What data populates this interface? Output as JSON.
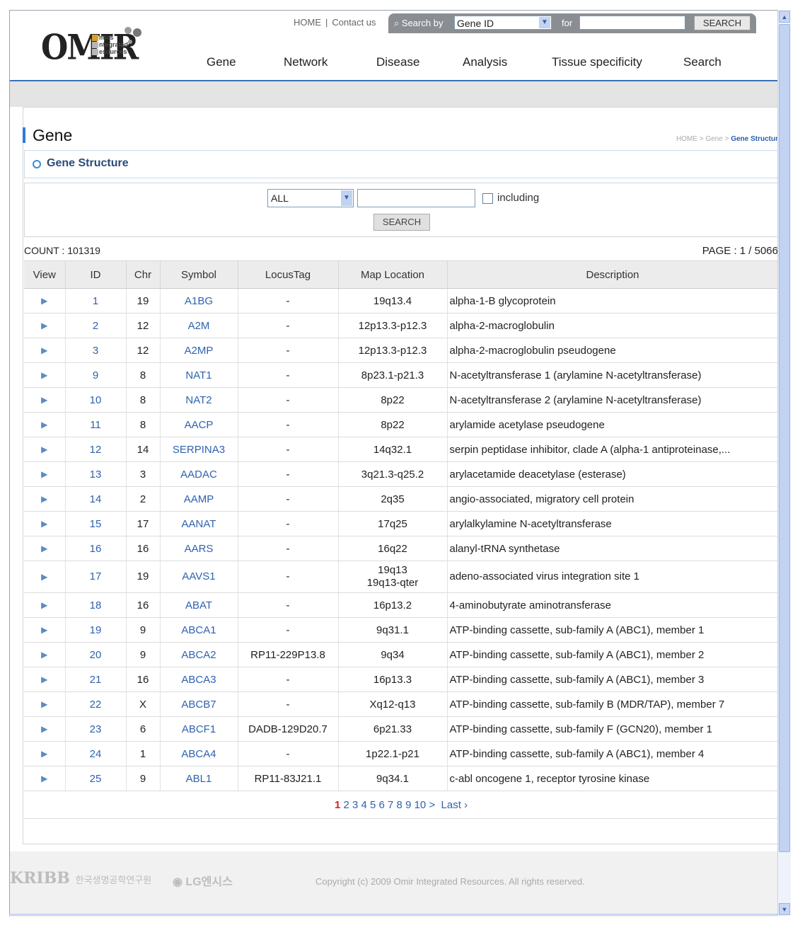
{
  "header": {
    "logo_big": "OMIR",
    "logo_small": [
      "mics",
      "ntegrated",
      "esources"
    ],
    "top_links": [
      "HOME",
      "Contact us"
    ],
    "search_by_label": "Search by",
    "search_by_value": "Gene ID",
    "for_label": "for",
    "search_button": "SEARCH",
    "nav": [
      "Gene",
      "Network",
      "Disease",
      "Analysis",
      "Tissue specificity",
      "Search"
    ]
  },
  "page": {
    "title": "Gene",
    "breadcrumb_prefix": "HOME > Gene > ",
    "breadcrumb_current": "Gene Structur",
    "subtitle": "Gene Structure"
  },
  "filter": {
    "select_value": "ALL",
    "input_value": "",
    "checkbox_label": "including",
    "search_button": "SEARCH"
  },
  "count_text": "COUNT : 101319",
  "page_text": "PAGE : 1 / 5066",
  "table": {
    "headers": [
      "View",
      "ID",
      "Chr",
      "Symbol",
      "LocusTag",
      "Map Location",
      "Description"
    ],
    "rows": [
      {
        "id": "1",
        "chr": "19",
        "symbol": "A1BG",
        "locus": "-",
        "map": "19q13.4",
        "desc": "alpha-1-B glycoprotein"
      },
      {
        "id": "2",
        "chr": "12",
        "symbol": "A2M",
        "locus": "-",
        "map": "12p13.3-p12.3",
        "desc": "alpha-2-macroglobulin"
      },
      {
        "id": "3",
        "chr": "12",
        "symbol": "A2MP",
        "locus": "-",
        "map": "12p13.3-p12.3",
        "desc": "alpha-2-macroglobulin pseudogene"
      },
      {
        "id": "9",
        "chr": "8",
        "symbol": "NAT1",
        "locus": "-",
        "map": "8p23.1-p21.3",
        "desc": "N-acetyltransferase 1 (arylamine N-acetyltransferase)"
      },
      {
        "id": "10",
        "chr": "8",
        "symbol": "NAT2",
        "locus": "-",
        "map": "8p22",
        "desc": "N-acetyltransferase 2 (arylamine N-acetyltransferase)"
      },
      {
        "id": "11",
        "chr": "8",
        "symbol": "AACP",
        "locus": "-",
        "map": "8p22",
        "desc": "arylamide acetylase pseudogene"
      },
      {
        "id": "12",
        "chr": "14",
        "symbol": "SERPINA3",
        "locus": "-",
        "map": "14q32.1",
        "desc": "serpin peptidase inhibitor, clade A (alpha-1 antiproteinase,..."
      },
      {
        "id": "13",
        "chr": "3",
        "symbol": "AADAC",
        "locus": "-",
        "map": "3q21.3-q25.2",
        "desc": "arylacetamide deacetylase (esterase)"
      },
      {
        "id": "14",
        "chr": "2",
        "symbol": "AAMP",
        "locus": "-",
        "map": "2q35",
        "desc": "angio-associated, migratory cell protein"
      },
      {
        "id": "15",
        "chr": "17",
        "symbol": "AANAT",
        "locus": "-",
        "map": "17q25",
        "desc": "arylalkylamine N-acetyltransferase"
      },
      {
        "id": "16",
        "chr": "16",
        "symbol": "AARS",
        "locus": "-",
        "map": "16q22",
        "desc": "alanyl-tRNA synthetase"
      },
      {
        "id": "17",
        "chr": "19",
        "symbol": "AAVS1",
        "locus": "-",
        "map": "19q13",
        "map2": "19q13-qter",
        "desc": "adeno-associated virus integration site 1"
      },
      {
        "id": "18",
        "chr": "16",
        "symbol": "ABAT",
        "locus": "-",
        "map": "16p13.2",
        "desc": "4-aminobutyrate aminotransferase"
      },
      {
        "id": "19",
        "chr": "9",
        "symbol": "ABCA1",
        "locus": "-",
        "map": "9q31.1",
        "desc": "ATP-binding cassette, sub-family A (ABC1), member 1"
      },
      {
        "id": "20",
        "chr": "9",
        "symbol": "ABCA2",
        "locus": "RP11-229P13.8",
        "map": "9q34",
        "desc": "ATP-binding cassette, sub-family A (ABC1), member 2"
      },
      {
        "id": "21",
        "chr": "16",
        "symbol": "ABCA3",
        "locus": "-",
        "map": "16p13.3",
        "desc": "ATP-binding cassette, sub-family A (ABC1), member 3"
      },
      {
        "id": "22",
        "chr": "X",
        "symbol": "ABCB7",
        "locus": "-",
        "map": "Xq12-q13",
        "desc": "ATP-binding cassette, sub-family B (MDR/TAP), member 7"
      },
      {
        "id": "23",
        "chr": "6",
        "symbol": "ABCF1",
        "locus": "DADB-129D20.7",
        "map": "6p21.33",
        "desc": "ATP-binding cassette, sub-family F (GCN20), member 1"
      },
      {
        "id": "24",
        "chr": "1",
        "symbol": "ABCA4",
        "locus": "-",
        "map": "1p22.1-p21",
        "desc": "ATP-binding cassette, sub-family A (ABC1), member 4"
      },
      {
        "id": "25",
        "chr": "9",
        "symbol": "ABL1",
        "locus": "RP11-83J21.1",
        "map": "9q34.1",
        "desc": "c-abl oncogene 1, receptor tyrosine kinase"
      }
    ]
  },
  "pager": {
    "current": "1",
    "pages": [
      "2",
      "3",
      "4",
      "5",
      "6",
      "7",
      "8",
      "9",
      "10"
    ],
    "next": ">",
    "last": "Last ›"
  },
  "footer": {
    "logo1": "KRIBB",
    "logo1_korean": "한국생명공학연구원",
    "logo2": "LG엔시스",
    "copyright": "Copyright (c) 2009 Omir Integrated Resources. All rights reserved."
  },
  "icons": {
    "view_arrow": "play-triangle-icon",
    "dropdown": "chevron-down-icon",
    "scroll_up": "scroll-up-icon",
    "scroll_down": "scroll-down-icon"
  },
  "colors": {
    "accent": "#3a6fb5",
    "link": "#2f62b0",
    "current_page": "#d42020"
  }
}
